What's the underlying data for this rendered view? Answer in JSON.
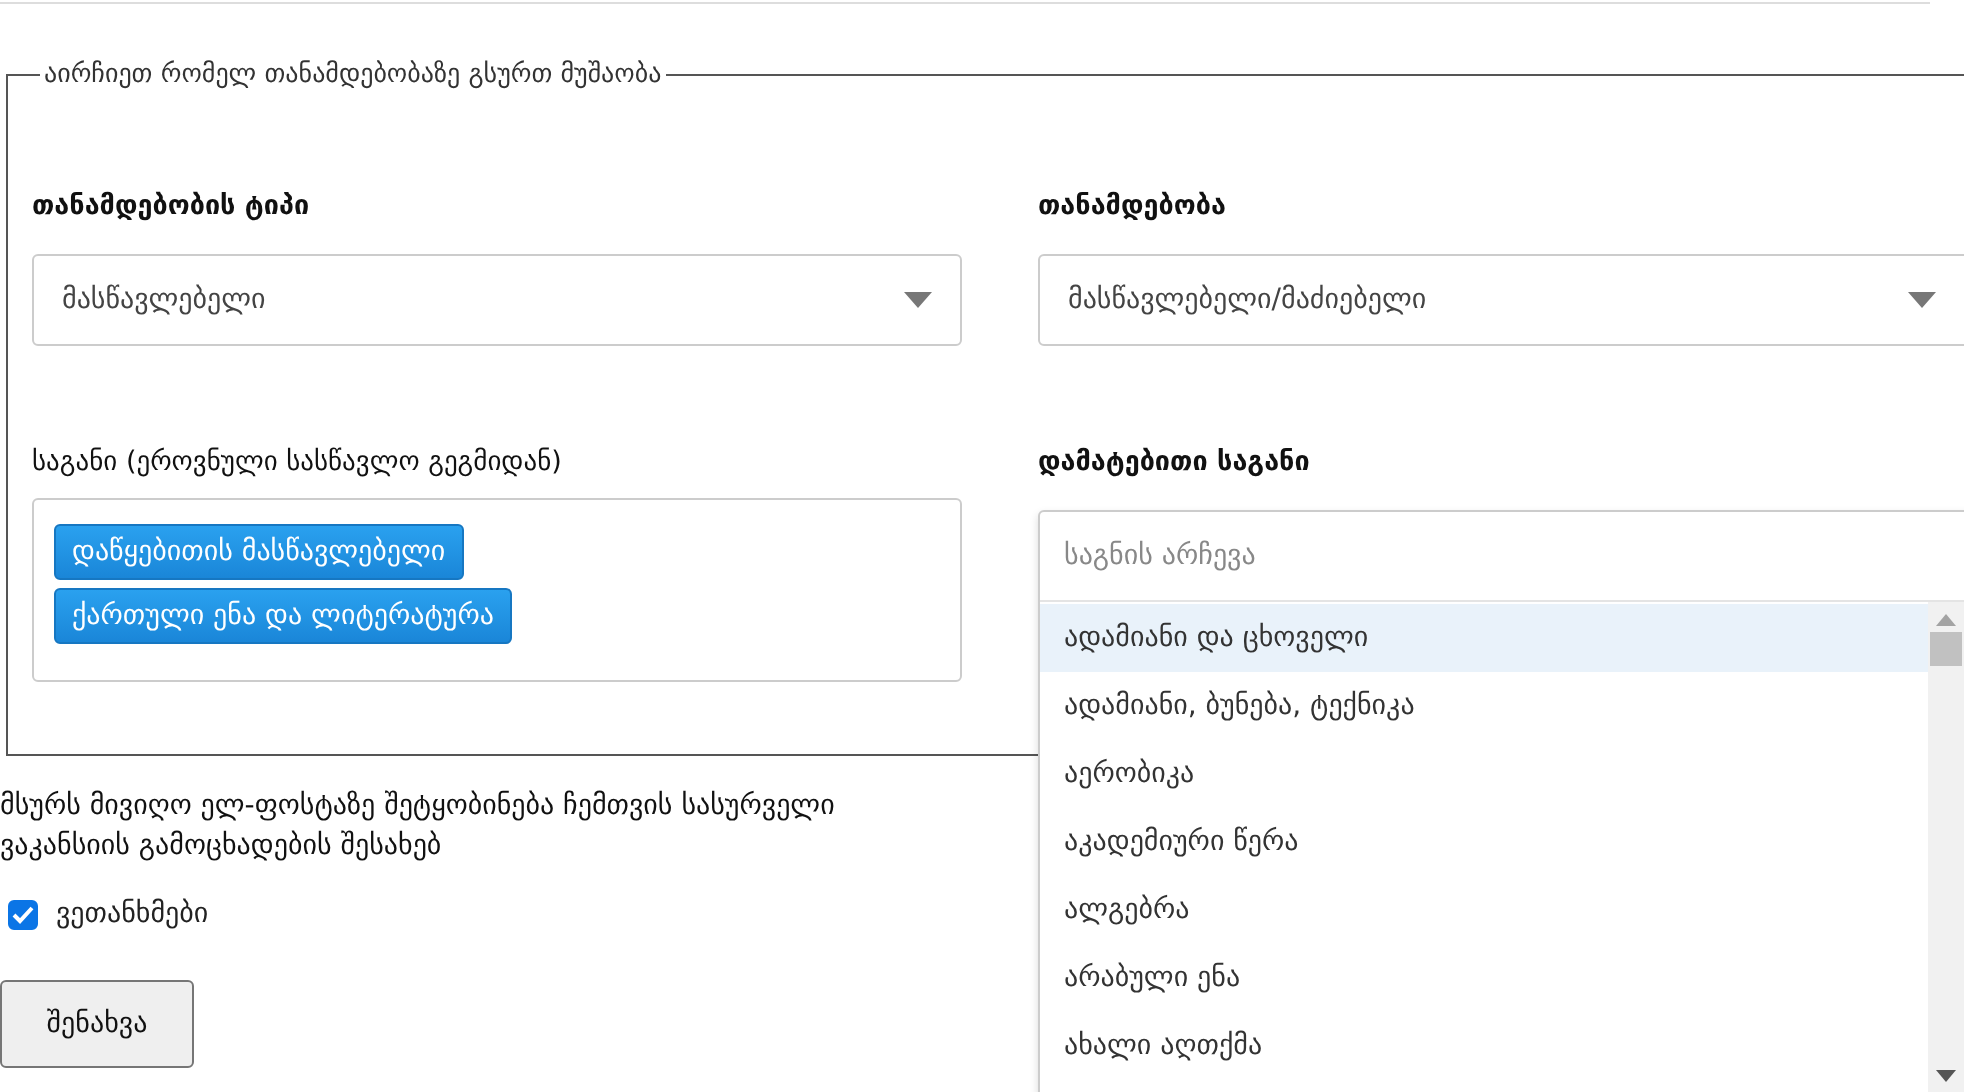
{
  "fieldset": {
    "legend": "აირჩიეთ რომელ თანამდებობაზე გსურთ მუშაობა",
    "position_type": {
      "label": "თანამდებობის ტიპი",
      "value": "მასწავლებელი"
    },
    "position": {
      "label": "თანამდებობა",
      "value": "მასწავლებელი/მაძიებელი"
    },
    "subject": {
      "label": "საგანი (ეროვნული სასწავლო გეგმიდან)",
      "tags": [
        "დაწყებითის მასწავლებელი",
        "ქართული ენა და ლიტერატურა"
      ]
    },
    "extra_subject": {
      "label": "დამატებითი საგანი",
      "placeholder": "საგნის არჩევა",
      "expanded": true,
      "options": [
        {
          "label": "ადამიანი და ცხოველი",
          "selected": true
        },
        {
          "label": "ადამიანი, ბუნება, ტექნიკა",
          "selected": false
        },
        {
          "label": "აერობიკა",
          "selected": false
        },
        {
          "label": "აკადემიური წერა",
          "selected": false
        },
        {
          "label": "ალგებრა",
          "selected": false
        },
        {
          "label": "არაბული ენა",
          "selected": false
        },
        {
          "label": "ახალი აღთქმა",
          "selected": false
        }
      ]
    }
  },
  "notify": {
    "text": "მსურს მივიღო ელ-ფოსტაზე შეტყობინება ჩემთვის სასურველი ვაკანსიის გამოცხადების შესახებ",
    "checkbox": {
      "label": "ვეთანხმები",
      "checked": true
    }
  },
  "save_button": "შენახვა"
}
